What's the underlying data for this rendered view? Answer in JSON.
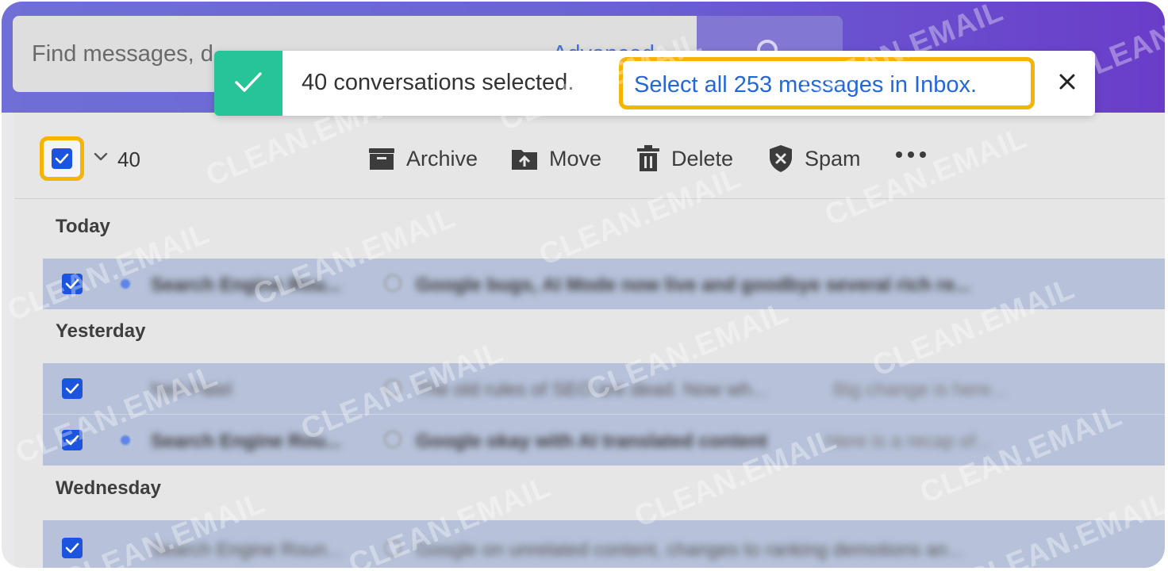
{
  "search": {
    "placeholder_visible": "Find messages, d",
    "advanced_fragment": "Advanced"
  },
  "toast": {
    "message": "40 conversations selected.",
    "link": "Select all 253 messages in Inbox.",
    "close": "×",
    "accent": "#27c498"
  },
  "toolbar": {
    "count": "40",
    "archive": "Archive",
    "move": "Move",
    "delete": "Delete",
    "spam": "Spam"
  },
  "groups": {
    "today": "Today",
    "yesterday": "Yesterday",
    "wednesday": "Wednesday"
  },
  "rows": [
    {
      "sender": "Search Engine Rou...",
      "subject": "Google bugs, AI Mode now live and goodbye several rich re...",
      "preview": "",
      "unread": true
    },
    {
      "sender": "Neil Patel",
      "subject": "The old rules of SEO are dead. Now wh...",
      "preview": "Big change is here...",
      "unread": false
    },
    {
      "sender": "Search Engine Rou...",
      "subject": "Google okay with AI translated content",
      "preview": "Here is a recap of...",
      "unread": true
    },
    {
      "sender": "Search Engine Roun...",
      "subject": "Google on unrelated content, changes to ranking demotions an...",
      "preview": "",
      "unread": false
    }
  ],
  "watermark": "CLEAN.EMAIL",
  "colors": {
    "topbar": "#6a63d4",
    "checkbox": "#1b55df",
    "highlight": "#f5b400",
    "link": "#2468d8",
    "selected_row": "#b7c2da"
  }
}
